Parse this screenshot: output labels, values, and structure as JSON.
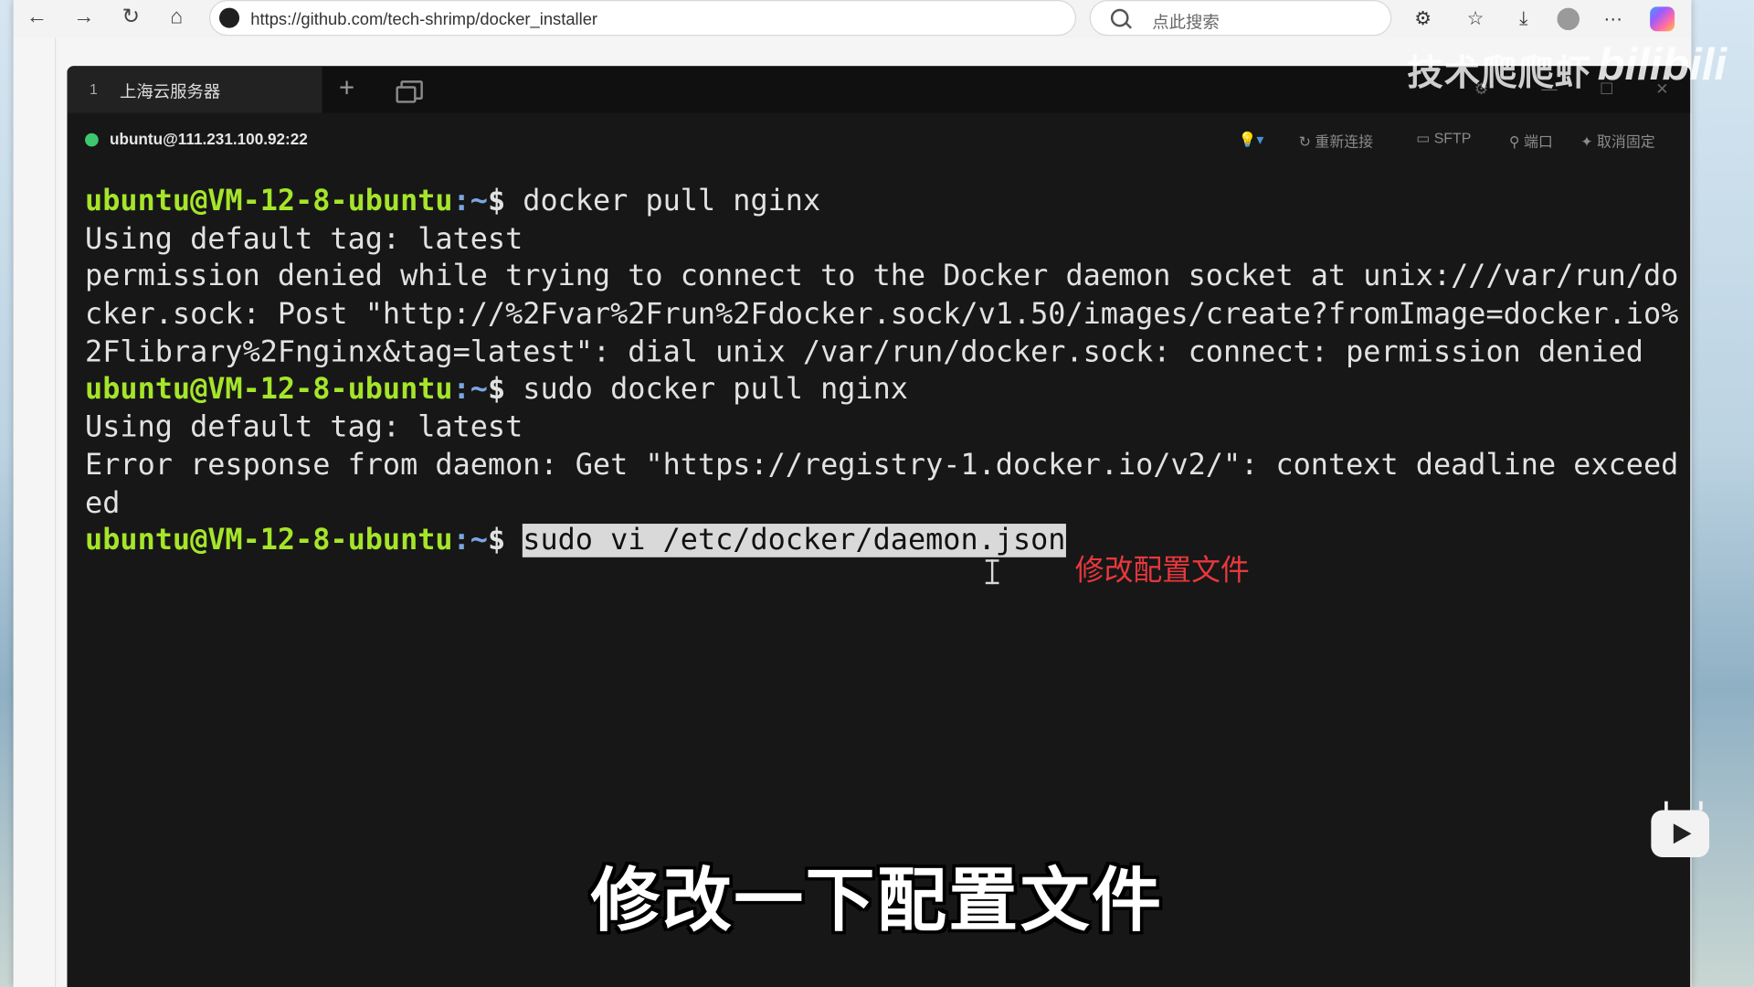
{
  "browser": {
    "url": "https://github.com/tech-shrimp/docker_installer",
    "search_placeholder": "点此搜索",
    "nav": {
      "back": "←",
      "forward": "→",
      "reload": "↻",
      "home": "⌂"
    },
    "icons": {
      "extensions": "⚙",
      "favorites": "☆",
      "downloads": "⤓",
      "more": "···"
    }
  },
  "terminal": {
    "tab": {
      "number": "1",
      "title": "上海云服务器"
    },
    "connection": "ubuntu@111.231.100.92:22",
    "actions": {
      "reconnect": "重新连接",
      "sftp": "SFTP",
      "port": "端口",
      "unpin": "取消固定"
    },
    "prompt": {
      "user": "ubuntu@VM-12-8-ubuntu",
      "path": ":~",
      "dollar": "$ "
    },
    "lines": [
      {
        "type": "cmd",
        "text": "docker pull nginx"
      },
      {
        "type": "out",
        "text": "Using default tag: latest"
      },
      {
        "type": "out",
        "text": "permission denied while trying to connect to the Docker daemon socket at unix:///var/run/do"
      },
      {
        "type": "out",
        "text": "cker.sock: Post \"http://%2Fvar%2Frun%2Fdocker.sock/v1.50/images/create?fromImage=docker.io%"
      },
      {
        "type": "out",
        "text": "2Flibrary%2Fnginx&tag=latest\": dial unix /var/run/docker.sock: connect: permission denied"
      },
      {
        "type": "cmd",
        "text": "sudo docker pull nginx"
      },
      {
        "type": "out",
        "text": "Using default tag: latest"
      },
      {
        "type": "out",
        "text": "Error response from daemon: Get \"https://registry-1.docker.io/v2/\": context deadline exceed"
      },
      {
        "type": "out",
        "text": "ed"
      },
      {
        "type": "cmd",
        "text": "sudo vi /etc/docker/daemon.json",
        "selected": true
      }
    ],
    "annotation": "修改配置文件"
  },
  "overlay": {
    "subtitle": "修改一下配置文件",
    "watermark": "技术爬爬虾",
    "bili_logo": "bilibili"
  },
  "colors": {
    "prompt_user": "#a5e52a",
    "prompt_path": "#7aa6e0",
    "annotation": "#e8383d",
    "status_dot": "#3dc86f"
  }
}
